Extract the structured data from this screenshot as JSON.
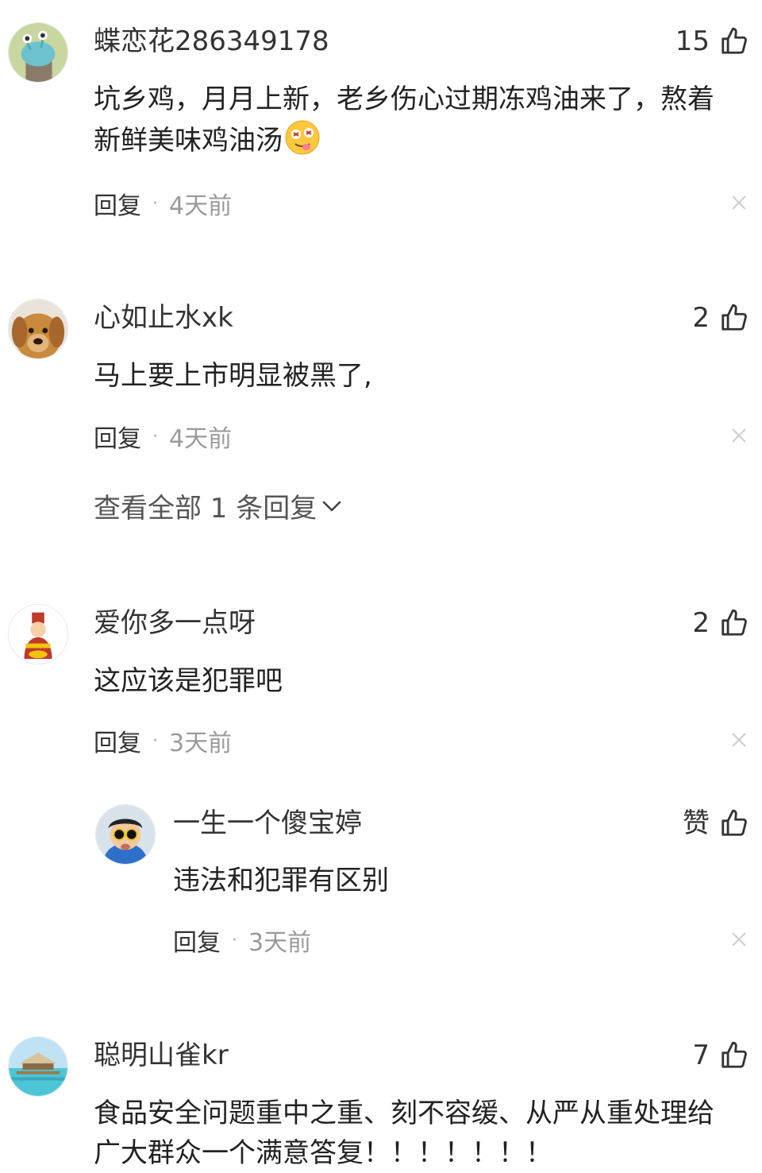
{
  "comments": [
    {
      "username": "蝶恋花286349178",
      "likes": "15",
      "content": "坑乡鸡，月月上新，老乡伤心过期冻鸡油来了，熬着新鲜美味鸡油汤",
      "emoji": "drooling-face-emoji",
      "reply_label": "回复",
      "time": "4天前"
    },
    {
      "username": "心如止水xk",
      "likes": "2",
      "content": "马上要上市明显被黑了,",
      "reply_label": "回复",
      "time": "4天前",
      "view_all_replies": "查看全部 1 条回复"
    },
    {
      "username": "爱你多一点呀",
      "likes": "2",
      "content": "这应该是犯罪吧",
      "reply_label": "回复",
      "time": "3天前",
      "replies": [
        {
          "username": "一生一个傻宝婷",
          "like_label": "赞",
          "content": "违法和犯罪有区别",
          "reply_label": "回复",
          "time": "3天前"
        }
      ]
    },
    {
      "username": "聪明山雀kr",
      "likes": "7",
      "content": "食品安全问题重中之重、刻不容缓、从严从重处理给广大群众一个满意答复！！！！！！！"
    }
  ],
  "icons": {
    "like": "thumbs-up-icon",
    "dismiss": "close-icon",
    "expand": "chevron-down-icon"
  },
  "colors": {
    "primary_text": "#222222",
    "secondary_text": "#9a9a9a"
  }
}
